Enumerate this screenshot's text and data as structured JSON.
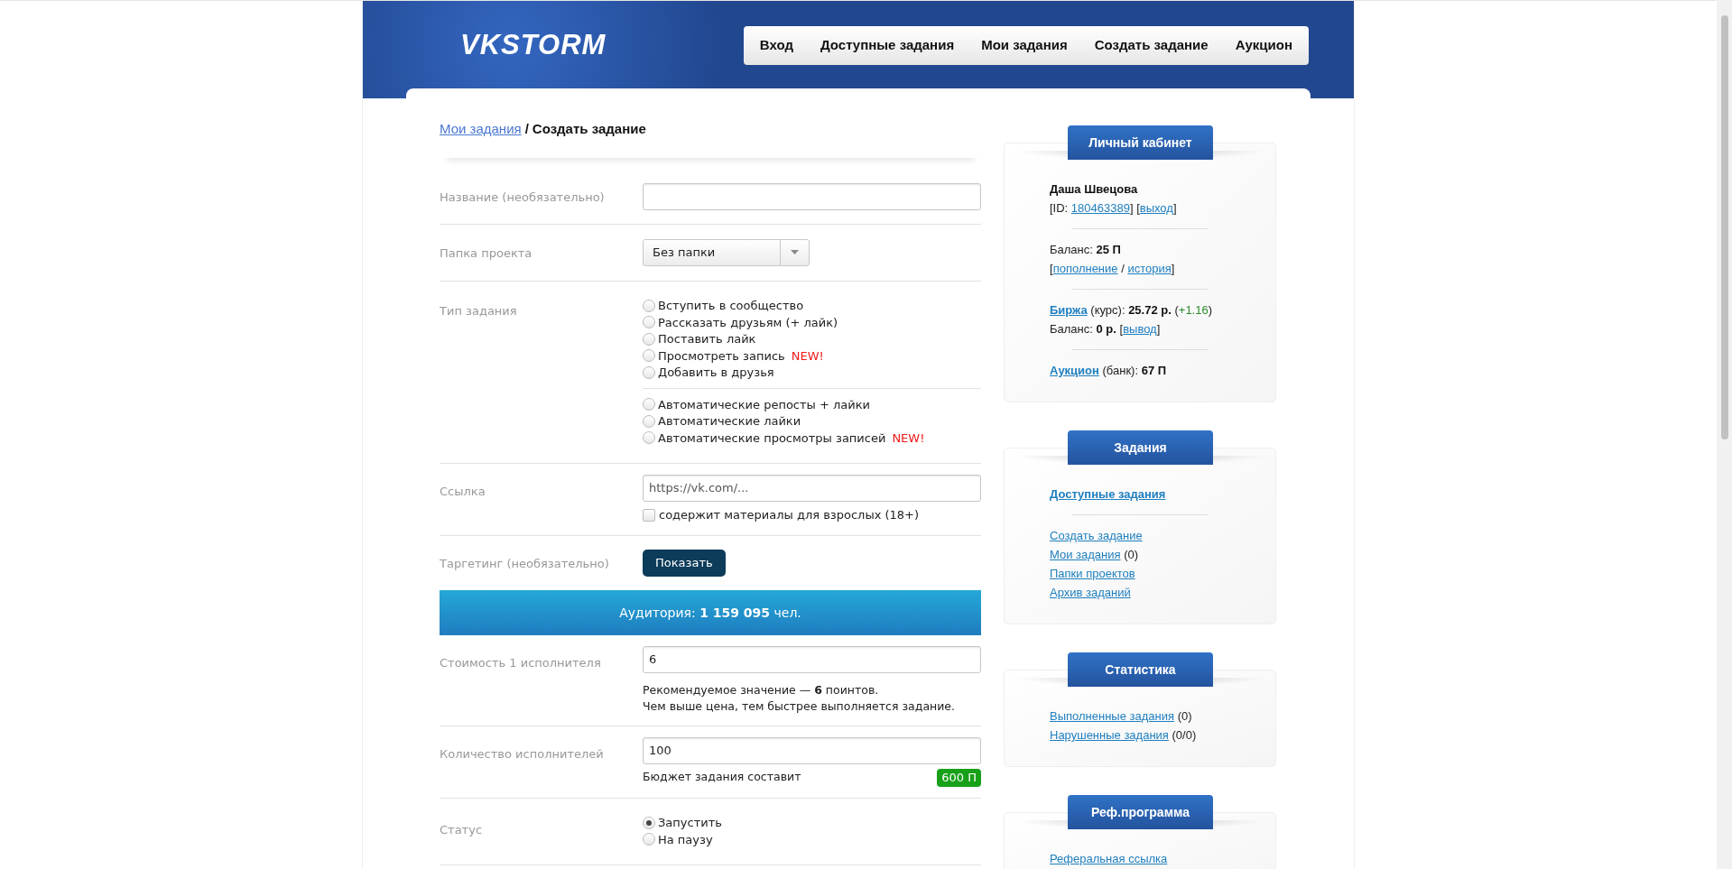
{
  "header": {
    "logo": "VKSTORM",
    "nav": [
      {
        "label": "Вход"
      },
      {
        "label": "Доступные задания"
      },
      {
        "label": "Мои задания"
      },
      {
        "label": "Создать задание"
      },
      {
        "label": "Аукцион"
      }
    ]
  },
  "breadcrumb": {
    "link": "Мои задания",
    "separator": "/",
    "current": "Создать задание"
  },
  "form": {
    "name": {
      "label": "Название (необязательно)"
    },
    "folder": {
      "label": "Папка проекта",
      "value": "Без папки"
    },
    "task_type": {
      "label": "Тип задания",
      "groups": [
        [
          {
            "text": "Вступить в сообщество",
            "selected": false
          },
          {
            "text": "Рассказать друзьям (+ лайк)",
            "selected": false
          },
          {
            "text": "Поставить лайк",
            "selected": false
          },
          {
            "text": "Просмотреть запись",
            "badge": "NEW!",
            "selected": false
          },
          {
            "text": "Добавить в друзья",
            "selected": false
          }
        ],
        [
          {
            "text": "Автоматические репосты + лайки",
            "selected": false
          },
          {
            "text": "Автоматические лайки",
            "selected": false
          },
          {
            "text": "Автоматические просмотры записей",
            "badge": "NEW!",
            "selected": false
          }
        ]
      ]
    },
    "link": {
      "label": "Ссылка",
      "placeholder": "https://vk.com/...",
      "adult": {
        "label": "содержит материалы для взрослых (18+)",
        "checked": false
      }
    },
    "targeting": {
      "label": "Таргетинг (необязательно)",
      "button": "Показать"
    },
    "audience": {
      "text": "Аудитория: **1 159 095** чел."
    },
    "cost": {
      "label": "Стоимость 1 исполнителя",
      "value": "6",
      "hint": [
        "Рекомендуемое значение — **6** поинтов.",
        "Чем выше цена, тем быстрее выполняется задание."
      ]
    },
    "count": {
      "label": "Количество исполнителей",
      "value": "100",
      "budget_label": "Бюджет задания составит",
      "budget": "600 П"
    },
    "status": {
      "label": "Статус",
      "options": [
        {
          "text": "Запустить",
          "selected": true
        },
        {
          "text": "На паузу",
          "selected": false
        }
      ]
    }
  },
  "sidebar": [
    {
      "title": "Личный кабинет",
      "sections": [
        [
          [
            {
              "kind": "bold",
              "text": "Даша Швецова"
            }
          ],
          [
            {
              "kind": "text",
              "text": "[ID: "
            },
            {
              "kind": "link",
              "text": "180463389"
            },
            {
              "kind": "text",
              "text": "] ["
            },
            {
              "kind": "link",
              "text": "выход"
            },
            {
              "kind": "text",
              "text": "]"
            }
          ]
        ],
        [
          [
            {
              "kind": "text",
              "text": "Баланс: "
            },
            {
              "kind": "bold",
              "text": "25 П"
            }
          ],
          [
            {
              "kind": "text",
              "text": "["
            },
            {
              "kind": "link",
              "text": "пополнение"
            },
            {
              "kind": "text",
              "text": " / "
            },
            {
              "kind": "link",
              "text": "история"
            },
            {
              "kind": "text",
              "text": "]"
            }
          ]
        ],
        [
          [
            {
              "kind": "bold_link",
              "text": "Биржа"
            },
            {
              "kind": "text",
              "text": " (курс): "
            },
            {
              "kind": "bold",
              "text": "25.72 р."
            },
            {
              "kind": "text",
              "text": " ("
            },
            {
              "kind": "green",
              "text": "+1.16"
            },
            {
              "kind": "text",
              "text": ")"
            }
          ],
          [
            {
              "kind": "text",
              "text": "Баланс: "
            },
            {
              "kind": "bold",
              "text": "0 р."
            },
            {
              "kind": "text",
              "text": " ["
            },
            {
              "kind": "link",
              "text": "вывод"
            },
            {
              "kind": "text",
              "text": "]"
            }
          ]
        ],
        [
          [
            {
              "kind": "bold_link",
              "text": "Аукцион"
            },
            {
              "kind": "text",
              "text": " (банк): "
            },
            {
              "kind": "bold",
              "text": "67 П"
            }
          ]
        ]
      ]
    },
    {
      "title": "Задания",
      "sections": [
        [
          [
            {
              "kind": "bold_link",
              "text": "Доступные задания"
            }
          ]
        ],
        [
          [
            {
              "kind": "link",
              "text": "Создать задание"
            }
          ],
          [
            {
              "kind": "link",
              "text": "Мои задания"
            },
            {
              "kind": "text",
              "text": " (0)"
            }
          ],
          [
            {
              "kind": "link",
              "text": "Папки проектов"
            }
          ],
          [
            {
              "kind": "link",
              "text": "Архив заданий"
            }
          ]
        ]
      ]
    },
    {
      "title": "Статистика",
      "sections": [
        [
          [
            {
              "kind": "link",
              "text": "Выполненные задания"
            },
            {
              "kind": "text",
              "text": " (0)"
            }
          ],
          [
            {
              "kind": "link",
              "text": "Нарушенные задания"
            },
            {
              "kind": "text",
              "text": " (0/0)"
            }
          ]
        ]
      ]
    },
    {
      "title": "Реф.программа",
      "sections": [
        [
          [
            {
              "kind": "link",
              "text": "Реферальная ссылка"
            }
          ]
        ]
      ]
    }
  ]
}
